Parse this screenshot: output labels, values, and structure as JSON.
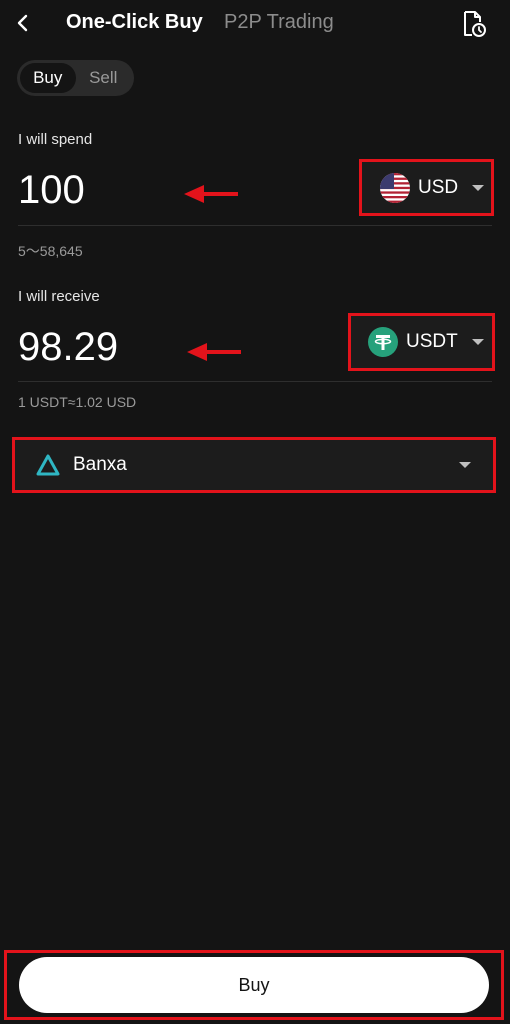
{
  "header": {
    "tab_active": "One-Click Buy",
    "tab_inactive": "P2P Trading"
  },
  "mode_toggle": {
    "buy_label": "Buy",
    "sell_label": "Sell",
    "selected": "Buy"
  },
  "spend": {
    "label": "I will spend",
    "amount": "100",
    "currency": "USD",
    "currency_icon": "us-flag-icon",
    "range": "5～58,645"
  },
  "receive": {
    "label": "I will receive",
    "amount": "98.29",
    "currency": "USDT",
    "currency_icon": "tether-icon",
    "rate": "1 USDT≈1.02 USD"
  },
  "provider": {
    "name": "Banxa",
    "icon": "banxa-logo-icon"
  },
  "actions": {
    "buy_label": "Buy"
  },
  "colors": {
    "background": "#141414",
    "highlight": "#e3131b",
    "tether": "#26a17b",
    "banxa": "#2fb6c3"
  }
}
